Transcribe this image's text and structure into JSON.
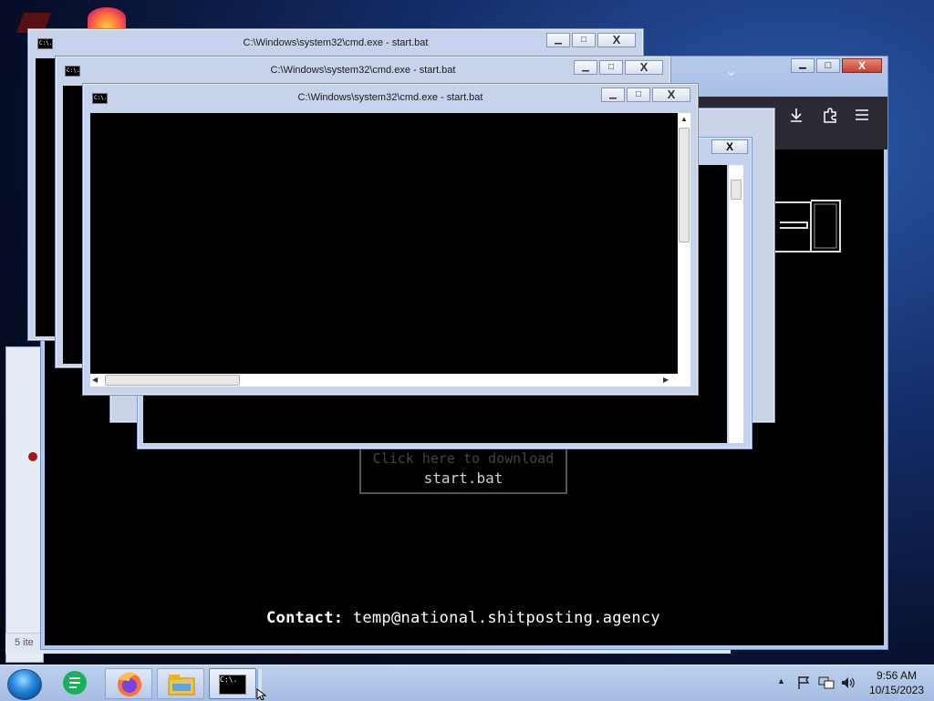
{
  "windows": {
    "cmd_title": "C:\\Windows\\system32\\cmd.exe - start.bat",
    "cmd_icon_text": "C:\\.",
    "min_glyph": "▁",
    "max_glyph": "□",
    "close_glyph": "X"
  },
  "browser": {
    "download_line1": "Click here to download",
    "download_line2": "start.bat",
    "contact_label": "Contact:",
    "contact_email": "temp@national.shitposting.agency",
    "toolbar_icons": [
      "pocket-icon",
      "download-icon",
      "extensions-icon",
      "menu-icon"
    ],
    "tab_chevron": "⌄"
  },
  "desktop": {
    "status_bar_fragment": "5 ite"
  },
  "taskbar": {
    "apps": [
      "google-sheets-icon",
      "firefox-icon",
      "file-explorer-icon",
      "cmd-icon"
    ],
    "time": "9:56 AM",
    "date": "10/15/2023"
  }
}
